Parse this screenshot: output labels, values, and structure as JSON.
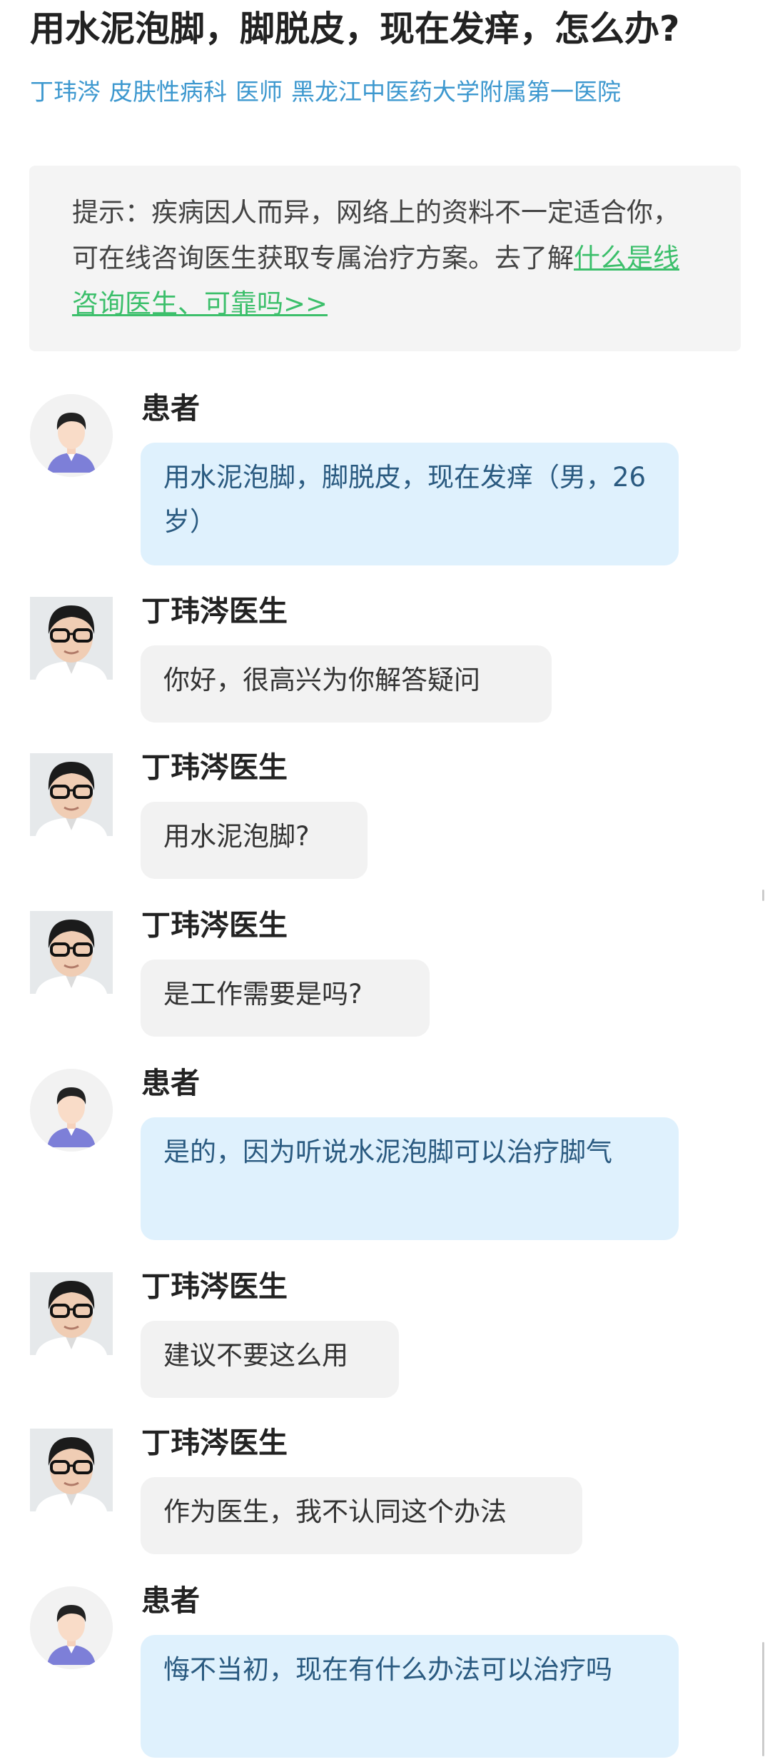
{
  "article": {
    "title": "用水泥泡脚，脚脱皮，现在发痒，怎么办?",
    "doctor_name": "丁玮涔",
    "department": "皮肤性病科",
    "doctor_title": "医师",
    "hospital": "黑龙江中医药大学附属第一医院"
  },
  "tip": {
    "text": "提示：疾病因人而异，网络上的资料不一定适合你，可在线咨询医生获取专属治疗方案。去了解",
    "link_text": "什么是线咨询医生、可靠吗>>"
  },
  "messages": [
    {
      "role": "patient",
      "sender": "患者",
      "text": "用水泥泡脚，脚脱皮，现在发痒（男，26岁）"
    },
    {
      "role": "doctor",
      "sender": "丁玮涔医生",
      "text": "你好，很高兴为你解答疑问"
    },
    {
      "role": "doctor",
      "sender": "丁玮涔医生",
      "text": "用水泥泡脚?"
    },
    {
      "role": "doctor",
      "sender": "丁玮涔医生",
      "text": "是工作需要是吗?"
    },
    {
      "role": "patient",
      "sender": "患者",
      "text": "是的，因为听说水泥泡脚可以治疗脚气"
    },
    {
      "role": "doctor",
      "sender": "丁玮涔医生",
      "text": "建议不要这么用"
    },
    {
      "role": "doctor",
      "sender": "丁玮涔医生",
      "text": "作为医生，我不认同这个办法"
    },
    {
      "role": "patient",
      "sender": "患者",
      "text": "悔不当初，现在有什么办法可以治疗吗"
    }
  ],
  "colors": {
    "byline": "#3d98cf",
    "link": "#3cbf6b",
    "patient_bubble": "#dff1fd",
    "doctor_bubble": "#f2f2f2"
  }
}
